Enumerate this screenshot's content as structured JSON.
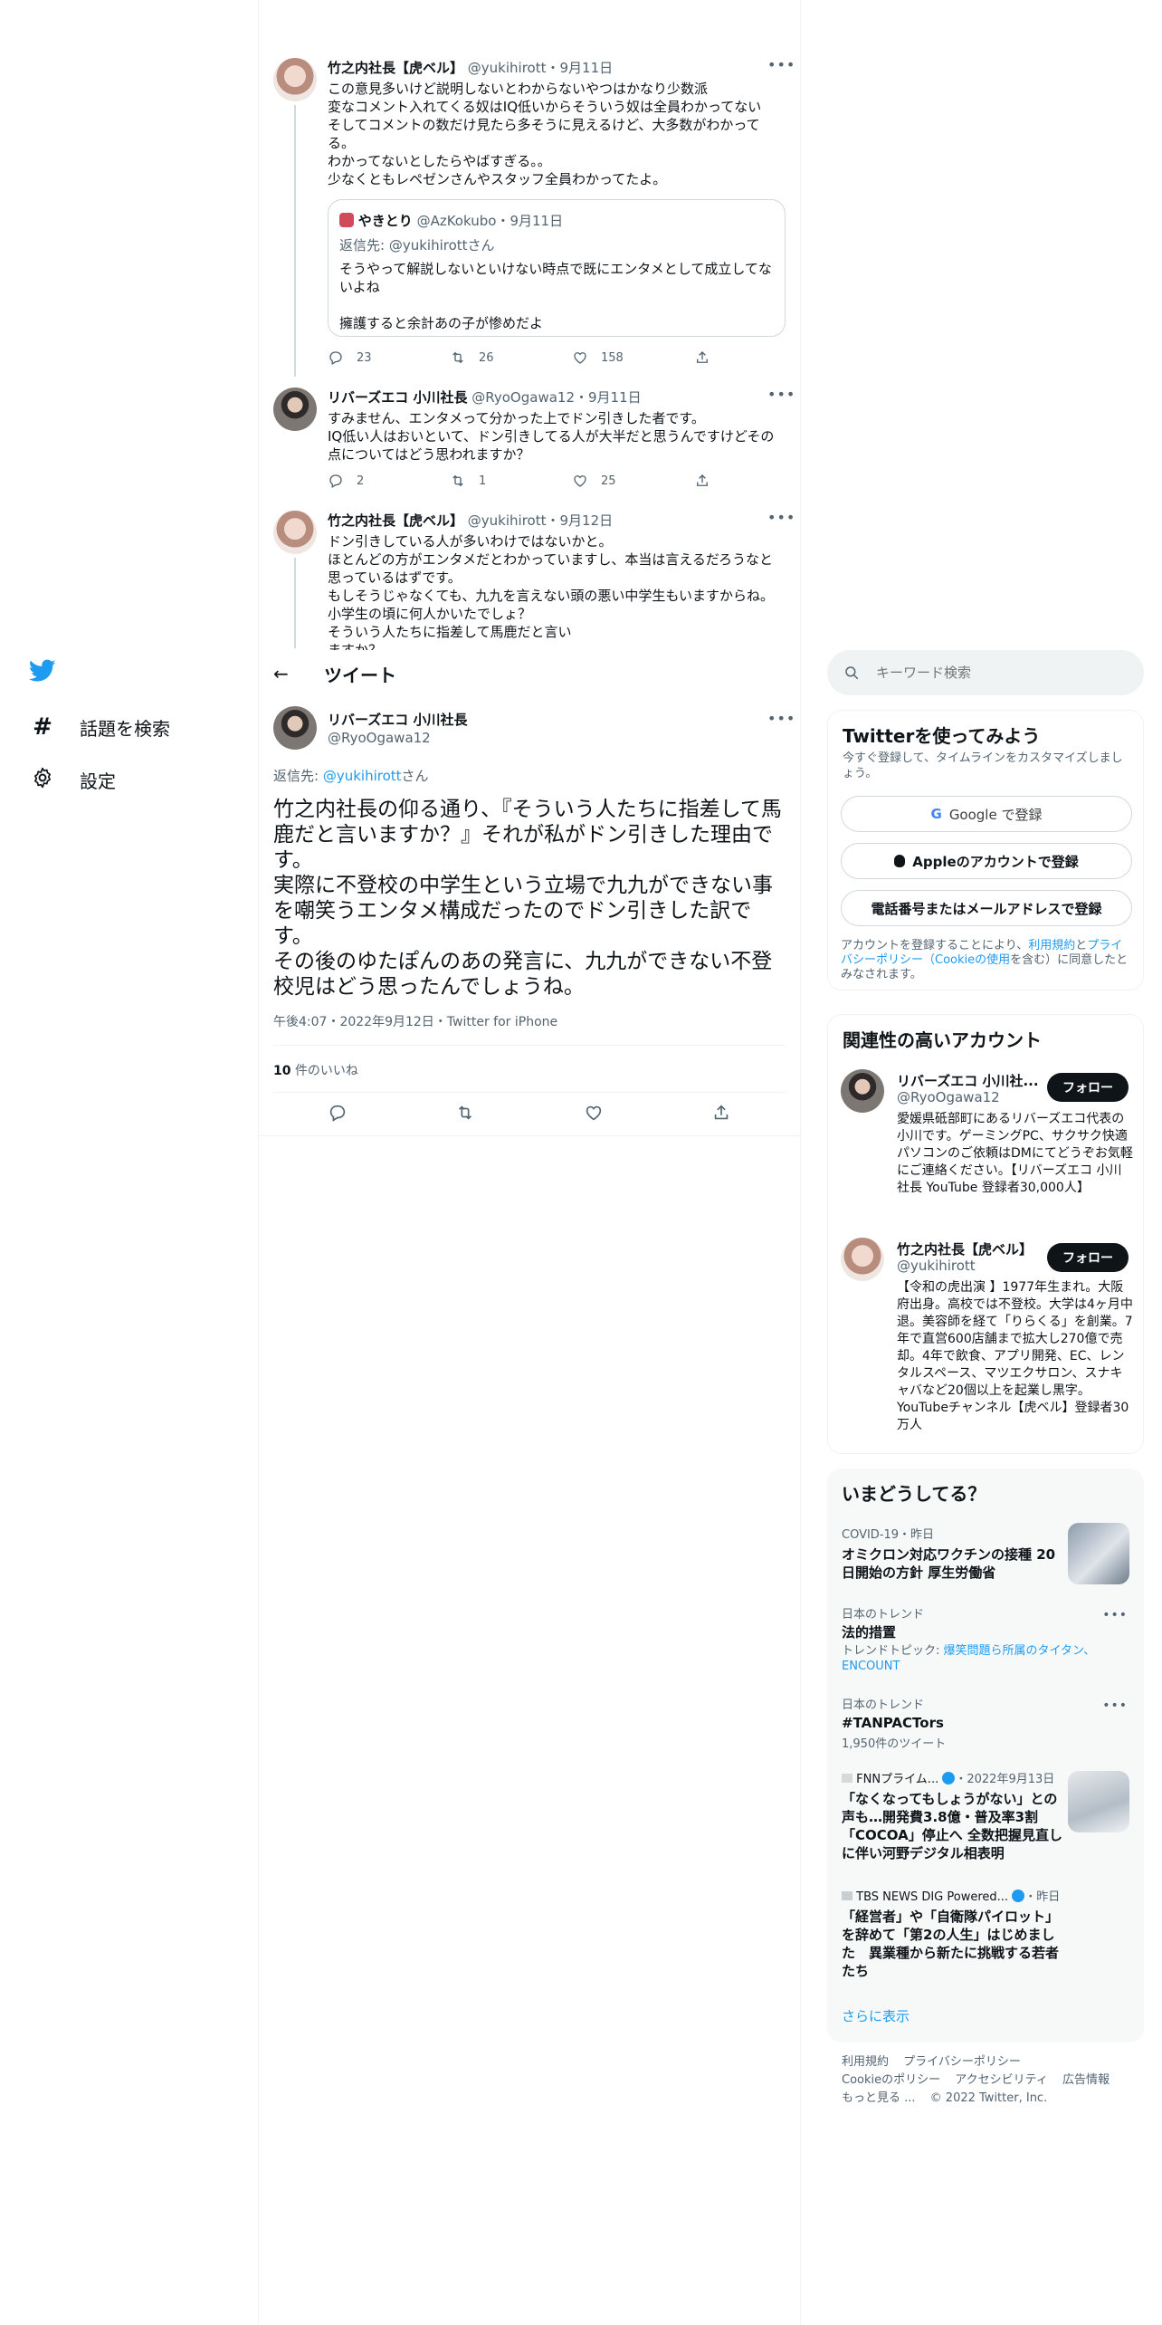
{
  "nav": {
    "explore_label": "話題を検索",
    "settings_label": "設定"
  },
  "thread": [
    {
      "name": "竹之内社長【虎ベル】",
      "handle": "@yukihirott",
      "date": "9月11日",
      "text": "この意見多いけど説明しないとわからないやつはかなり少数派\n変なコメント入れてくる奴はIQ低いからそういう奴は全員わかってない\nそしてコメントの数だけ見たら多そうに見えるけど、大多数がわかってる。\nわかってないとしたらやばすぎる。。\n少なくともレペゼンさんやスタッフ全員わかってたよ。",
      "quote": {
        "name": "やきとり",
        "handle": "@AzKokubo",
        "date": "9月11日",
        "reply_prefix": "返信先: ",
        "reply_handle": "@yukihirott",
        "reply_suffix": "さん",
        "text": "そうやって解説しないといけない時点で既にエンタメとして成立してないよね\n\n擁護すると余計あの子が惨めだよ"
      },
      "replies": "23",
      "retweets": "26",
      "likes": "158"
    },
    {
      "name": "リバーズエコ 小川社長",
      "handle": "@RyoOgawa12",
      "date": "9月11日",
      "text": "すみません、エンタメって分かった上でドン引きした者です。\nIQ低い人はおいといて、ドン引きしてる人が大半だと思うんですけどその点についてはどう思われますか？",
      "replies": "2",
      "retweets": "1",
      "likes": "25"
    },
    {
      "name": "竹之内社長【虎ベル】",
      "handle": "@yukihirott",
      "date": "9月12日",
      "text": "ドン引きしている人が多いわけではないかと。\nほとんどの方がエンタメだとわかっていますし、本当は言えるだろうなと思っているはずです。\nもしそうじゃなくても、九九を言えない頭の悪い中学生もいますからね。\n小学生の頃に何人かいたでしょ？\nそういう人たちに指差して馬鹿だと言い\nますか？"
    }
  ],
  "header": {
    "title": "ツイート"
  },
  "main_tweet": {
    "name": "リバーズエコ 小川社長",
    "handle": "@RyoOgawa12",
    "reply_prefix": "返信先: ",
    "reply_handle": "@yukihirott",
    "reply_suffix": "さん",
    "text": "竹之内社長の仰る通り、『そういう人たちに指差して馬鹿だと言いますか？』それが私がドン引きした理由です。\n実際に不登校の中学生という立場で九九ができない事を嘲笑うエンタメ構成だったのでドン引きした訳です。\nその後のゆたぽんのあの発言に、九九ができない不登校児はどう思ったんでしょうね。",
    "timestamp": "午後4:07・2022年9月12日・Twitter for iPhone",
    "likes_count": "10",
    "likes_label": "件のいいね"
  },
  "search": {
    "placeholder": "キーワード検索"
  },
  "signup": {
    "title": "Twitterを使ってみよう",
    "subtitle": "今すぐ登録して、タイムラインをカスタマイズしましょう。",
    "google_label": "Google で登録",
    "apple_label": "Appleのアカウントで登録",
    "phone_label": "電話番号またはメールアドレスで登録",
    "legal_prefix": "アカウントを登録することにより、",
    "legal_link1": "利用規約",
    "legal_and": "と",
    "legal_link2": "プライバシーポリシー（Cookieの使用",
    "legal_suffix": "を含む）に同意したとみなされます。"
  },
  "related": {
    "title": "関連性の高いアカウント",
    "follow_label": "フォロー",
    "accounts": [
      {
        "name": "リバーズエコ 小川社...",
        "handle": "@RyoOgawa12",
        "bio": "愛媛県砥部町にあるリバーズエコ代表の小川です。ゲーミングPC、サクサク快適パソコンのご依頼はDMにてどうぞお気軽にご連絡ください。【リバーズエコ 小川社長 YouTube 登録者30,000人】"
      },
      {
        "name": "竹之内社長【虎ベル】",
        "handle": "@yukihirott",
        "bio": "【令和の虎出演 】1977年生まれ。大阪府出身。高校では不登校。大学は4ヶ月中退。美容師を経て「りらくる」を創業。7年で直営600店舗まで拡大し270億で売却。4年で飲食、アプリ開発、EC、レンタルスペース、マツエクサロン、スナキャバなど20個以上を起業し黒字。YouTubeチャンネル【虎ベル】登録者30万人"
      }
    ]
  },
  "trends": {
    "title": "いまどうしてる？",
    "items": [
      {
        "meta": "COVID-19・昨日",
        "title": "オミクロン対応ワクチンの接種 20日開始の方針 厚生労働省"
      },
      {
        "meta": "日本のトレンド",
        "title": "法的措置",
        "sub_prefix": "トレンドトピック: ",
        "sub_links": "爆笑問題ら所属のタイタン、ENCOUNT"
      },
      {
        "meta": "日本のトレンド",
        "title": "#TANPACTors",
        "sub": "1,950件のツイート"
      },
      {
        "meta": "FNNプライム...",
        "meta_date": "・2022年9月13日",
        "title": "「なくなってもしょうがない」との声も…開発費3.8億・普及率3割「COCOA」停止へ 全数把握見直しに伴い河野デジタル相表明"
      },
      {
        "meta": "TBS NEWS DIG Powered...",
        "meta_date": "・昨日",
        "title": "「経営者」や「自衛隊パイロット」を辞めて「第2の人生」はじめました　異業種から新たに挑戦する若者たち"
      }
    ],
    "show_more": "さらに表示"
  },
  "footer": {
    "row1": [
      "利用規約",
      "プライバシーポリシー"
    ],
    "row2": [
      "Cookieのポリシー",
      "アクセシビリティ",
      "広告情報"
    ],
    "more": "もっと見る ...",
    "copyright": "© 2022 Twitter, Inc."
  },
  "colors": {
    "accent": "#1d9bf0",
    "text": "#0f1419",
    "secondary": "#536471",
    "border": "#eff3f4"
  }
}
